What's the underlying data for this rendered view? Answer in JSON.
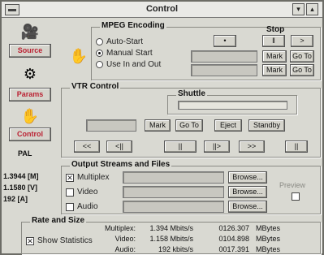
{
  "window": {
    "title": "Control"
  },
  "titlebar": {
    "minimize_glyph": "▾",
    "maximize_glyph": "▴"
  },
  "sidebar": {
    "source_label": "Source",
    "params_label": "Params",
    "control_label": "Control",
    "format": "PAL",
    "rates": [
      "1.3944 [M]",
      "1.1580 [V]",
      "192 [A]"
    ]
  },
  "mpeg": {
    "title": "MPEG Encoding",
    "options": [
      "Auto-Start",
      "Manual Start",
      "Use In and Out"
    ],
    "selected_index": 1,
    "stop_label": "Stop",
    "record_glyph": "•",
    "pause_glyph": "‖",
    "play_glyph": ">",
    "mark_label": "Mark",
    "goto_label": "Go To"
  },
  "vtr": {
    "title": "VTR Control",
    "shuttle_label": "Shuttle",
    "mark_label": "Mark",
    "goto_label": "Go To",
    "eject_label": "Eject",
    "standby_label": "Standby",
    "transport": [
      "<<",
      "<||",
      "||",
      "||>",
      ">>",
      "||"
    ]
  },
  "output": {
    "title": "Output Streams and Files",
    "streams": [
      {
        "label": "Multiplex",
        "checked": true
      },
      {
        "label": "Video",
        "checked": false
      },
      {
        "label": "Audio",
        "checked": false
      }
    ],
    "browse_label": "Browse...",
    "preview_label": "Preview"
  },
  "rate": {
    "title": "Rate and Size",
    "show_stats_label": "Show Statistics",
    "rows": [
      {
        "name": "Multiplex:",
        "rate": "1.394 Mbits/s",
        "size": "0126.307",
        "unit": "MBytes"
      },
      {
        "name": "Video:",
        "rate": "1.158 Mbits/s",
        "size": "0104.898",
        "unit": "MBytes"
      },
      {
        "name": "Audio:",
        "rate": "192 kbits/s",
        "size": "0017.391",
        "unit": "MBytes"
      }
    ]
  }
}
